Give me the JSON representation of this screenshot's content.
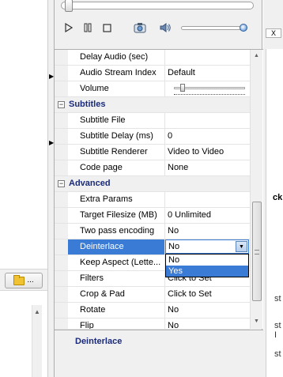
{
  "properties": {
    "rows_top": [
      {
        "name": "Delay Audio (sec)",
        "value": ""
      },
      {
        "name": "Audio Stream Index",
        "value": "Default"
      },
      {
        "name": "Volume",
        "value": ""
      }
    ],
    "subtitles": {
      "title": "Subtitles",
      "rows": [
        {
          "name": "Subtitle File",
          "value": ""
        },
        {
          "name": "Subtitle Delay (ms)",
          "value": "0"
        },
        {
          "name": "Subtitle Renderer",
          "value": "Video to Video"
        },
        {
          "name": "Code page",
          "value": "None"
        }
      ]
    },
    "advanced": {
      "title": "Advanced",
      "rows": [
        {
          "name": "Extra Params",
          "value": ""
        },
        {
          "name": "Target Filesize (MB)",
          "value": "0 Unlimited"
        },
        {
          "name": "Two pass encoding",
          "value": "No"
        },
        {
          "name": "Deinterlace",
          "value": "No"
        },
        {
          "name": "Keep Aspect (Lette...",
          "value": ""
        },
        {
          "name": "Filters",
          "value": "Click to Set"
        },
        {
          "name": "Crop & Pad",
          "value": "Click to Set"
        },
        {
          "name": "Rotate",
          "value": "No"
        },
        {
          "name": "Flip",
          "value": "No"
        }
      ]
    }
  },
  "dropdown": {
    "current": "No",
    "options": [
      "No",
      "Yes"
    ],
    "highlighted": "Yes"
  },
  "description": {
    "title": "Deinterlace"
  },
  "left_toolbar": {
    "browse_label": "..."
  },
  "right_partial": {
    "close": "X",
    "label": "ck",
    "st1": "st",
    "st2": "st I",
    "st3": "st"
  },
  "colors": {
    "selection": "#3a7bd5",
    "category_text": "#1a2a7a"
  }
}
